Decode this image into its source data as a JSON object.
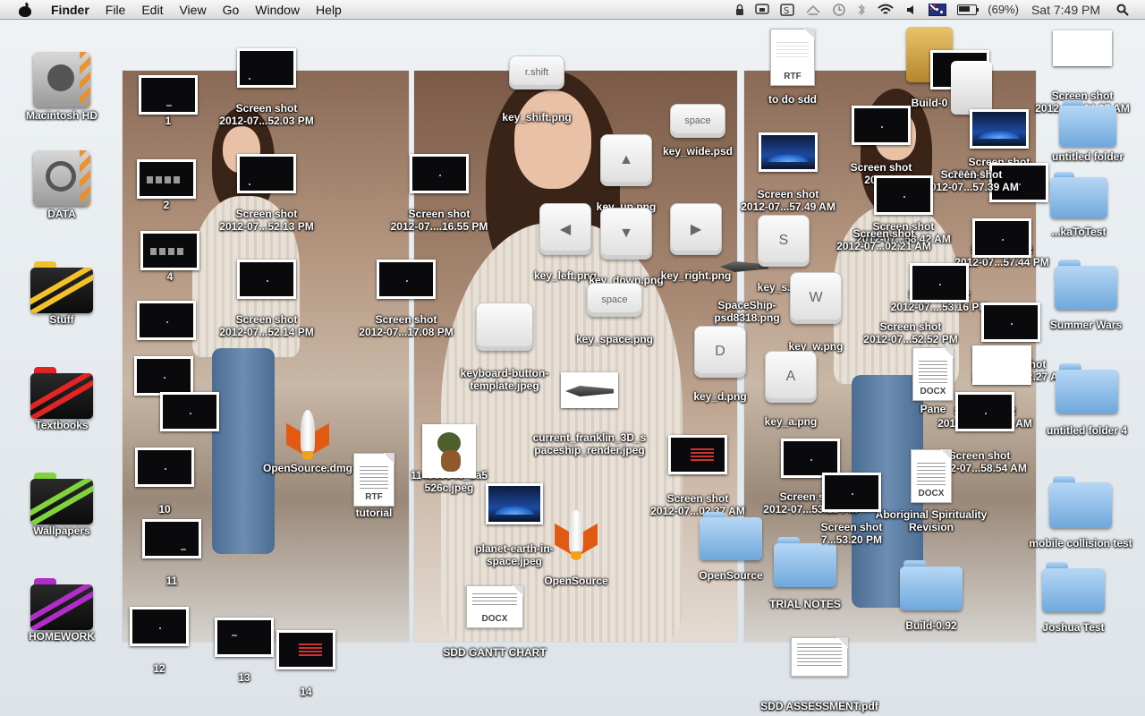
{
  "menubar": {
    "app_name": "Finder",
    "menus": [
      "File",
      "Edit",
      "View",
      "Go",
      "Window",
      "Help"
    ],
    "battery_text": "(69%)",
    "clock": "Sat 7:49 PM",
    "tray_icons": [
      "lock-icon",
      "screen-icon",
      "s-icon",
      "sync-icon",
      "time-machine-icon",
      "bluetooth-icon",
      "wifi-icon",
      "volume-icon",
      "flag-icon",
      "battery-icon",
      "spotlight-icon"
    ]
  },
  "desktop": {
    "left_column": [
      {
        "label": "Macintosh HD",
        "kind": "drive"
      },
      {
        "label": "DATA",
        "kind": "drive-fw"
      },
      {
        "label": "Stuff",
        "kind": "folder-yellow"
      },
      {
        "label": "Textbooks",
        "kind": "folder-red"
      },
      {
        "label": "Wallpapers",
        "kind": "folder-green"
      },
      {
        "label": "HOMEWORK",
        "kind": "folder-purple"
      }
    ],
    "numbered": [
      "1",
      "2",
      "4",
      "10",
      "11",
      "12",
      "13",
      "14"
    ],
    "screenshots": {
      "s1": "Screen shot\n2012-07...52.03 PM",
      "s2": "Screen shot\n2012-07...52.13 PM",
      "s3": "Screen shot\n2012-07...52.14 PM",
      "s4": "Screen shot\n2012-07....16.55 PM",
      "s5": "Screen shot\n2012-07...17.08 PM",
      "s6": "Screen shot\n2012-07...02.37 AM",
      "s7": "Screen shot\n2012-07...53.22 PM",
      "s8": "Screen shot\n7...53.20 PM",
      "s9": "Screen shot\n2012-07...02.21 AM",
      "s10": "Screen shot\n2012-07....53.16 PM",
      "s11": "Screen shot\n2012-07...52.52 PM",
      "s12": "Screen shot\n2012-07...02.27 A",
      "s13": "Screen shot\n2012-07...21.39 AM",
      "s14": "Screen shot\n2012-07...58.54 AM",
      "s15": "Screen shot\n2012-07...57.44 PM",
      "s16": "Screen shot\n2012-07...58.42 AM",
      "s17": "Screen shot\n2012-07...57.39 AM",
      "s18": "Screen shot\n2012-07...56.39 PM",
      "s19": "Screen shot\n2012-07...57.49 AM",
      "s20": "Screen shot\n2012-07...04.27 AM",
      "s21": "Screen shot\n2012-0"
    },
    "keys": {
      "shift": {
        "cap": "r.shift",
        "label": "key_shift.png"
      },
      "wide": {
        "cap": "space",
        "label": "key_wide.psd"
      },
      "up": {
        "cap": "▲",
        "label": "key_up.png"
      },
      "left": {
        "cap": "◀",
        "label": "key_left.png"
      },
      "down": {
        "cap": "▼",
        "label": "key_down.png"
      },
      "right": {
        "cap": "▶",
        "label": "key_right.png"
      },
      "space": {
        "cap": "space",
        "label": "key_space.png"
      },
      "s": {
        "cap": "S",
        "label": "key_s.png"
      },
      "w": {
        "cap": "W",
        "label": "key_w.png"
      },
      "d": {
        "cap": "D",
        "label": "key_d.png"
      },
      "a": {
        "cap": "A",
        "label": "key_a.png"
      }
    },
    "files": {
      "to_do_sdd": {
        "tag": "RTF",
        "label": "to do sdd"
      },
      "tutorial": {
        "tag": "RTF",
        "label": "tutorial"
      },
      "sdd_gantt": {
        "tag": "DOCX",
        "label": "SDD GANTT CHART"
      },
      "sdd_assessment": {
        "label": "SDD ASSESSMENT.pdf"
      },
      "docx1": {
        "tag": "DOCX",
        "label": "Pane"
      },
      "aboriginal": {
        "tag": "DOCX",
        "label": "Aboriginal Spirituality\nRevision"
      },
      "keyboard_template": {
        "label": "keyboard-button-\ntemplate.jpeg"
      },
      "franklin": {
        "label": "current_franklin_3D_s\npaceship_render.jpeg"
      },
      "mascot_file": {
        "label": "114585346_1a5\n526c.jpeg"
      },
      "planet": {
        "label": "planet-earth-in-\nspace.jpeg"
      },
      "spaceship_psd": {
        "label": "SpaceShip-\npsd8318.png"
      },
      "opensource_dmg": {
        "label": "OpenSource.dmg"
      },
      "opensource_app": {
        "label": "OpenSource"
      },
      "build_top": {
        "label": "Build-0"
      }
    },
    "folders": {
      "opensource": "OpenSource",
      "trial_notes": "TRIAL NOTES",
      "build_092": "Build-0.92",
      "untitled": "untitled folder",
      "kato": "...kaToTest",
      "summer": "Summer Wars",
      "untitled4": "untitled folder 4",
      "mobile": "mobile collision test",
      "joshua": "Joshua Test"
    }
  }
}
